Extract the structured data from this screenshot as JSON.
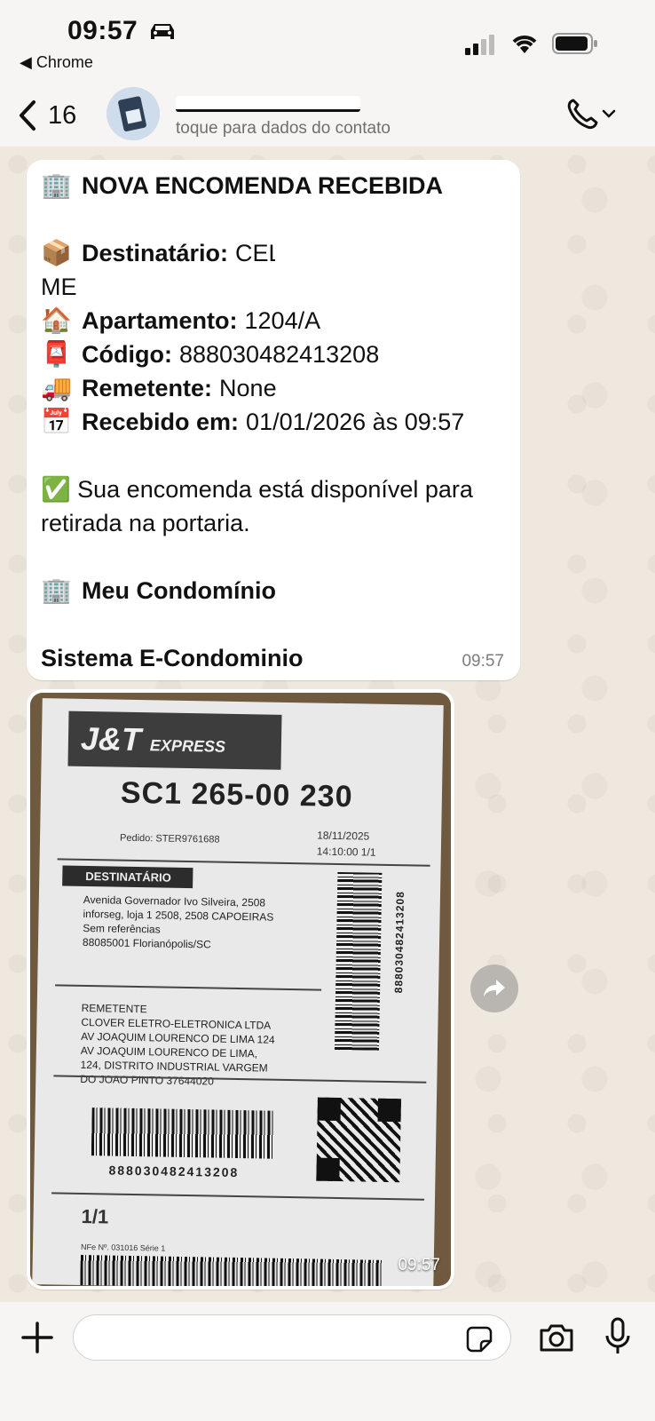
{
  "status_bar": {
    "time": "09:57",
    "back_app": "◀ Chrome"
  },
  "header": {
    "back_count": "16",
    "contact_subtitle": "toque para dados do contato"
  },
  "message": {
    "title_emoji": "🏢",
    "title": "NOVA ENCOMENDA RECEBIDA",
    "recipient_emoji": "📦",
    "recipient_label": "Destinatário:",
    "recipient_value": "CELIO JOSE",
    "recipient_value_line2": "MEDEIROS",
    "apartment_emoji": "🏠",
    "apartment_label": "Apartamento:",
    "apartment_value": "1204/A",
    "code_emoji": "📮",
    "code_label": "Código:",
    "code_value": "888030482413208",
    "sender_emoji": "🚚",
    "sender_label": "Remetente:",
    "sender_value": "None",
    "received_emoji": "📅",
    "received_label": "Recebido em:",
    "received_value": "01/01/2026 às 09:57",
    "available_emoji": "✅",
    "available_text": "Sua encomenda está disponível para retirada na portaria.",
    "condo_emoji": "🏢",
    "condo_name": "Meu Condomínio",
    "signature": "Sistema E-Condominio",
    "time": "09:57"
  },
  "photo": {
    "brand": "J&T",
    "brand_sub": "EXPRESS",
    "sort_code": "SC1 265-00 230",
    "order": "Pedido: STER9761688",
    "date_line1": "18/11/2025",
    "date_line2": "14:10:00 1/1",
    "dest_tag": "DESTINATÁRIO",
    "dest_line1": "Avenida Governador Ivo Silveira, 2508",
    "dest_line2": "inforseg, loja 1 2508, 2508 CAPOEIRAS",
    "dest_line3": "Sem referências",
    "dest_line4": "88085001 Florianópolis/SC",
    "rem_line1": "REMETENTE",
    "rem_line2": "CLOVER ELETRO-ELETRONICA LTDA",
    "rem_line3": "AV JOAQUIM LOURENCO DE LIMA 124",
    "rem_line4": "AV JOAQUIM LOURENCO DE LIMA,",
    "rem_line5": "124, DISTRITO INDUSTRIAL VARGEM",
    "rem_line6": "DO JOAO PINTO 37644020",
    "barcode_number": "888030482413208",
    "page": "1/1",
    "nfe": "NFe Nº. 031016 Série 1",
    "time": "09:57"
  },
  "composer": {
    "placeholder": ""
  },
  "colors": {
    "chat_background": "#efe9e1",
    "bubble": "#ffffff",
    "header": "#f6f5f3"
  }
}
